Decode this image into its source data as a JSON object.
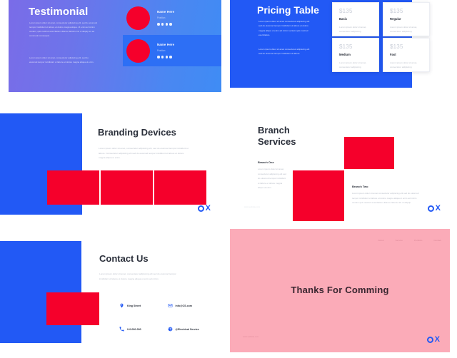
{
  "theme": {
    "blue": "#2259f5",
    "red": "#f5002b",
    "pink": "#fbabb8",
    "gradient_from": "#7a6ce8",
    "gradient_to": "#3f8cf4",
    "dark_text": "#2a2f3a",
    "muted_text": "#b9bec9"
  },
  "logo": {
    "mark": "O",
    "letter": "X"
  },
  "slides": [
    {
      "id": "testimonial",
      "title": "Testimonial",
      "paragraph_1": "Lorem ipsum dolor sit amet, consectetur adipiscing elit, sed do eiusmod tempor incididunt ut labore et dolore magna aliqua. Ut enim ad minim veniam, quis nostrud exercitation ullamco laboris nisi ut aliquip ex ea commodo consequat.",
      "paragraph_2": "Lorem ipsum dolor sit amet, consectetur adipiscing elit, sed do eiusmod tempor incididunt ut labore et dolore magna aliqua ut enim.",
      "cards": [
        {
          "name": "Name Here",
          "role": "Position",
          "rating": 4
        },
        {
          "name": "Name Here",
          "role": "Position",
          "rating": 4
        }
      ]
    },
    {
      "id": "pricing-table",
      "title": "Pricing Table",
      "paragraph_1": "Lorem ipsum dolor sit amet consectetur adipiscing elit sed do eiusmod tempor incididunt ut labore et dolore magna aliqua ut enim ad minim veniam quis nostrud exercitation.",
      "paragraph_2": "Lorem ipsum dolor sit amet consectetur adipiscing elit sed do eiusmod tempor incididunt ut labore.",
      "cards": [
        {
          "price": "$135",
          "name": "Basic",
          "desc": "Lorem ipsum dolor sit amet, consectetur adipiscing"
        },
        {
          "price": "$135",
          "name": "Regular",
          "desc": "Lorem ipsum dolor sit amet, consectetur adipiscing"
        },
        {
          "price": "$135",
          "name": "Medium",
          "desc": "Lorem ipsum dolor sit amet, consectetur adipiscing"
        },
        {
          "price": "$135",
          "name": "Fast",
          "desc": "Lorem ipsum dolor sit amet, consectetur adipiscing"
        }
      ]
    },
    {
      "id": "branding-devices",
      "title": "Branding Devices",
      "paragraph": "Lorem ipsum dolor sit amet, consectetur adipiscing elit, sed do eiusmod tempor incididunt ut labore. Consectetur adipiscing elit sed do eiusmod tempor incididunt ut labore et dolore magna aliqua ut enim."
    },
    {
      "id": "branch-services",
      "title": "Branch\nServices",
      "title_line_1": "Branch",
      "title_line_2": "Services",
      "branch_one": {
        "label": "Branch One",
        "text": "Lorem ipsum dolor sit amet, consectetur adipiscing elit sed do eiusmod tempor incididunt ut labore et dolore magna aliqua ut enim."
      },
      "branch_two": {
        "label": "Branch Two",
        "text": "Lorem ipsum dolor sit amet consectetur adipiscing elit sed do eiusmod tempor incididunt ut labore et dolore magna aliqua ut enim ad minim veniam quis nostrud exercitation ullamco laboris nisi ut aliquip."
      },
      "website": "www.website.com"
    },
    {
      "id": "contact-us",
      "title": "Contact Us",
      "paragraph": "Lorem ipsum dolor sit amet, consectetur adipiscing elit sed do eiusmod tempor incididunt ut labore et dolore magna aliqua ut enim ad minim.",
      "contacts": [
        {
          "icon": "location-icon",
          "label": "King Street"
        },
        {
          "icon": "mail-icon",
          "label": "info@CS.com"
        },
        {
          "icon": "phone-icon",
          "label": "0-0-000-000"
        },
        {
          "icon": "globe-icon",
          "label": "@Electrical Service"
        }
      ]
    },
    {
      "id": "thanks",
      "heading": "Thanks For Comming",
      "nav": [
        "About",
        "Service",
        "Portfolio",
        "Contact"
      ],
      "website": "www.website.com"
    }
  ]
}
